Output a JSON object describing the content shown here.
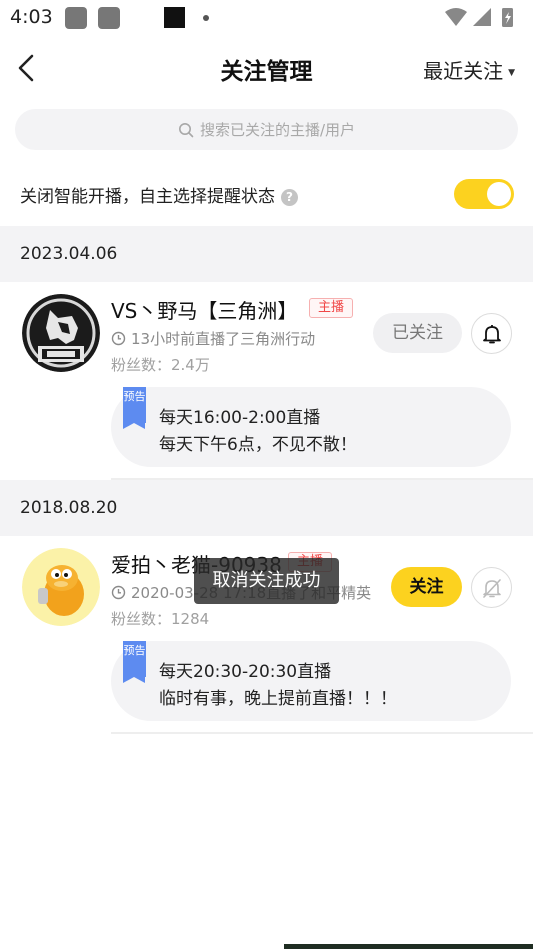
{
  "status_bar": {
    "time": "4:03"
  },
  "header": {
    "title": "关注管理",
    "sort_label": "最近关注",
    "sort_caret": "▼"
  },
  "search": {
    "placeholder": "搜索已关注的主播/用户"
  },
  "smart_setting": {
    "label": "关闭智能开播，自主选择提醒状态",
    "help": "?",
    "enabled": true
  },
  "sections": [
    {
      "date": "2023.04.06",
      "entry": {
        "name": "VS丶野马【三角洲】",
        "badge": "主播",
        "last_live": "13小时前直播了三角洲行动",
        "fans": "粉丝数：2.4万",
        "follow_label": "已关注",
        "bell_state": "on",
        "notice_tag": "预告",
        "notice_line1": "每天16:00-2:00直播",
        "notice_line2": "每天下午6点，不见不散！"
      }
    },
    {
      "date": "2018.08.20",
      "entry": {
        "name": "爱拍丶老猫-90938",
        "badge": "主播",
        "last_live": "2020-03-28 17:18直播了和平精英",
        "fans": "粉丝数：1284",
        "follow_label": "关注",
        "bell_state": "off",
        "notice_tag": "预告",
        "notice_line1": "每天20:30-20:30直播",
        "notice_line2": "临时有事，晚上提前直播！！！"
      }
    }
  ],
  "toast": "取消关注成功",
  "colors": {
    "accent": "#fcd21f",
    "badge_red": "#f04848",
    "notice_tag": "#5d8bf0"
  }
}
